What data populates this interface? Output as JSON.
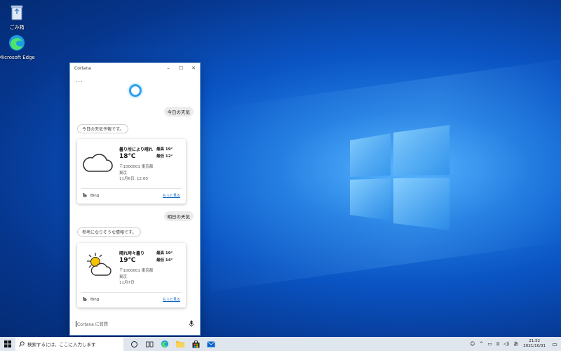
{
  "desktop": {
    "icons": [
      {
        "label": "ごみ箱",
        "icon": "recycle-bin-icon"
      },
      {
        "label": "Microsoft Edge",
        "icon": "edge-icon"
      }
    ]
  },
  "window": {
    "title": "Cortana",
    "more_label": "...",
    "controls": {
      "minimize": "–",
      "maximize": "☐",
      "close": "✕"
    }
  },
  "conversation": {
    "q1": "今日の天気",
    "r1": "今日の天気予報です。",
    "card1": {
      "condition": "曇り所により晴れ",
      "temp": "18℃",
      "high": "最高 19°",
      "low": "最低 12°",
      "loc1": "〒1000001 東京都",
      "loc2": "東京",
      "date": "11月6日, 12:00",
      "source": "Bing",
      "more": "もっと見る"
    },
    "q2": "明日の天気",
    "r2": "参考になりそうな情報です。",
    "card2": {
      "condition": "晴れ時々曇り",
      "temp": "19℃",
      "high": "最高 19°",
      "low": "最低 14°",
      "loc1": "〒1000001 東京都",
      "loc2": "東京",
      "date": "11月7日",
      "source": "Bing",
      "more": "もっと見る"
    }
  },
  "ask": {
    "placeholder": "Cortana に質問"
  },
  "taskbar": {
    "search_placeholder": "検索するには、ここに入力します",
    "ime": "あ",
    "time": "21:52",
    "date": "2021/10/31"
  },
  "colors": {
    "accent": "#2ea0ec",
    "link": "#0a64c8",
    "taskbar": "#dfe6ee"
  }
}
